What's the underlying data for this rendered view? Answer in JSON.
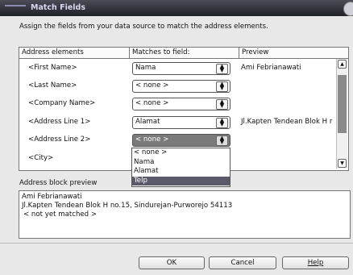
{
  "dialog": {
    "title": "Match Fields",
    "instruction": "Assign the fields from your data source to match the address elements."
  },
  "grid": {
    "headers": {
      "address_elements": "Address elements",
      "matches_to_field": "Matches to field:",
      "preview": "Preview"
    },
    "rows": [
      {
        "element": "<First Name>",
        "match": "Nama",
        "preview": "Ami Febrianawati"
      },
      {
        "element": "<Last Name>",
        "match": "< none >",
        "preview": ""
      },
      {
        "element": "<Company Name>",
        "match": "< none >",
        "preview": ""
      },
      {
        "element": "<Address Line 1>",
        "match": "Alamat",
        "preview": "Jl.Kapten Tendean Blok H r"
      },
      {
        "element": "<Address Line 2>",
        "match": "< none >",
        "preview": ""
      },
      {
        "element": "<City>",
        "match": "",
        "preview": ""
      }
    ],
    "dropdown_options": [
      "< none >",
      "Nama",
      "Alamat",
      "Telp"
    ],
    "dropdown_highlighted": "Telp"
  },
  "address_block": {
    "label": "Address block preview",
    "lines": [
      "Ami Febrianawati",
      "Jl.Kapten Tendean Blok H no.15, Sindurejan-Purworejo 54113",
      "< not yet matched >"
    ]
  },
  "buttons": {
    "ok": "OK",
    "cancel": "Cancel",
    "help": "Help"
  },
  "icons": {
    "combo_arrow": "updown-arrows-icon",
    "scroll_up": "chevron-up-icon",
    "scroll_down": "chevron-down-icon"
  }
}
